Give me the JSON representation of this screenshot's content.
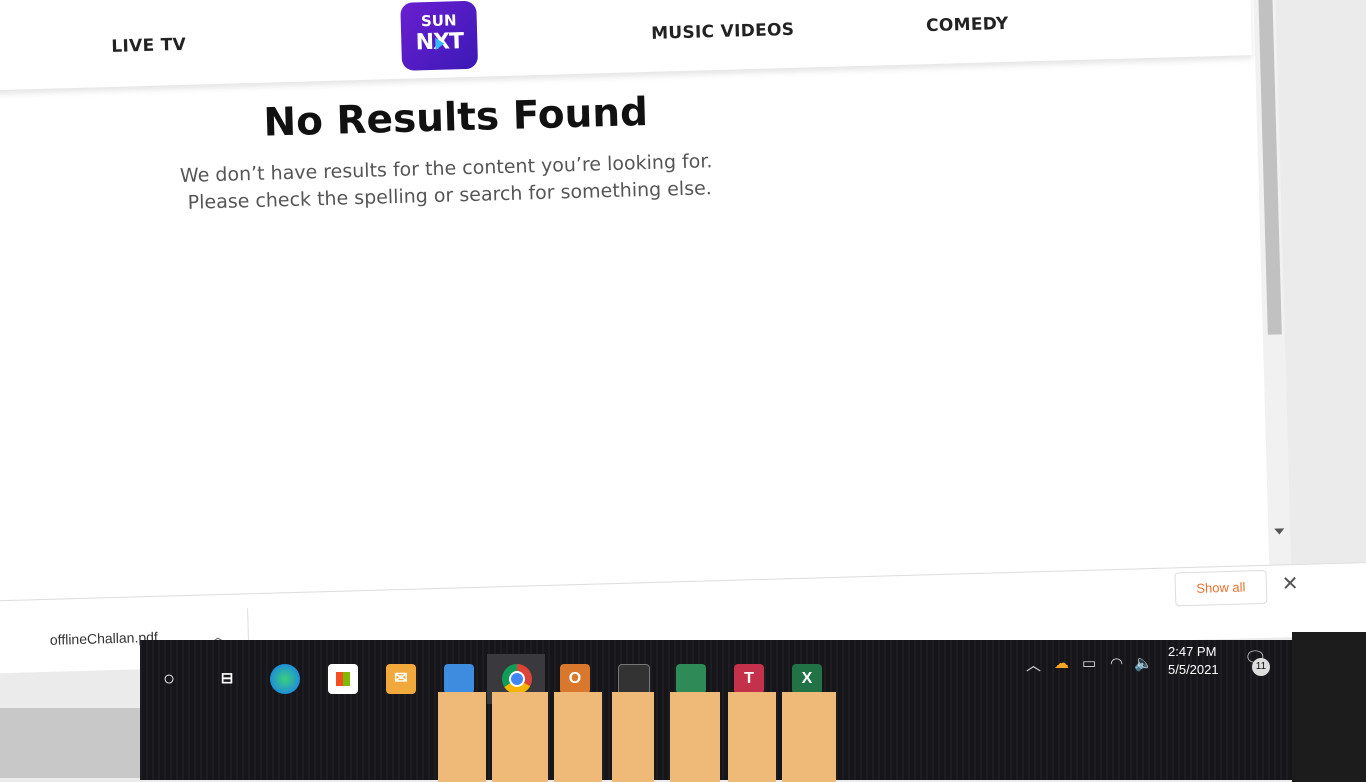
{
  "nav": {
    "live_tv": "LIVE TV",
    "music_videos": "MUSIC VIDEOS",
    "comedy": "COMEDY",
    "logo_line1": "SUN",
    "logo_line2": "NXT"
  },
  "main": {
    "title": "No Results Found",
    "message_line1": "We don’t have results for the content you’re looking for.",
    "message_line2": "Please check the spelling or search for something else."
  },
  "download_shelf": {
    "file_name": "offlineChallan.pdf",
    "show_all_label": "Show all"
  },
  "taskbar": {
    "time": "2:47 PM",
    "date": "5/5/2021",
    "notification_count": "11",
    "icons": [
      "start-circle-icon",
      "task-view-icon",
      "edge-icon",
      "store-icon",
      "mail-icon",
      "file-explorer-icon",
      "chrome-icon",
      "outlook-icon",
      "terminal-icon",
      "sway-icon",
      "teams-icon",
      "excel-icon"
    ]
  },
  "colors": {
    "brand_purple": "#3b0aa8",
    "show_all_orange": "#e8722c",
    "taskbar": "#16161a"
  }
}
